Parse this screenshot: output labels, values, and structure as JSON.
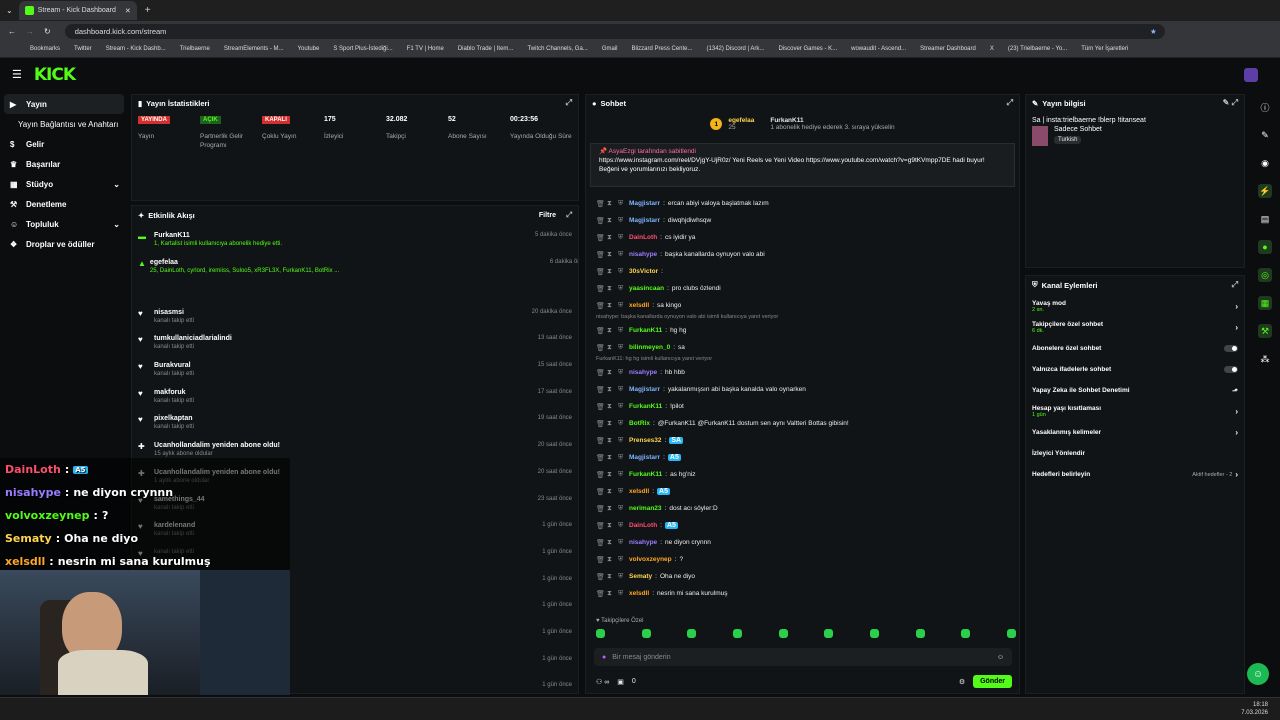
{
  "browser": {
    "tab_title": "Stream - Kick Dashboard",
    "url": "dashboard.kick.com/stream",
    "bookmarks": [
      "Bookmarks",
      "Twitter",
      "Stream - Kick Dashb...",
      "Trielbaerne",
      "StreamElements - M...",
      "Youtube",
      "S Sport Plus-İstediği...",
      "F1 TV | Home",
      "Diablo Trade | Item...",
      "Twitch Channels, Ga...",
      "Gmail",
      "Blizzard Press Cente...",
      "(1342) Discord | Ark...",
      "Discover Games - K...",
      "wowaudit - Ascend...",
      "Streamer Dashboard",
      "X",
      "(23) Trielbaerne - Yo...",
      "Tüm Yer İşaretleri"
    ]
  },
  "logo": "KICK",
  "sidebar": {
    "items": [
      {
        "label": "Yayın",
        "icon": "video-icon"
      },
      {
        "label": "Yayın Bağlantısı ve Anahtarı"
      },
      {
        "label": "Gelir",
        "icon": "money-icon"
      },
      {
        "label": "Başarılar",
        "icon": "trophy-icon"
      },
      {
        "label": "Stüdyo",
        "icon": "studio-icon"
      },
      {
        "label": "Denetleme",
        "icon": "hammer-icon"
      },
      {
        "label": "Topluluk",
        "icon": "people-icon"
      },
      {
        "label": "Droplar ve ödüller",
        "icon": "gift-icon"
      }
    ]
  },
  "stats": {
    "title": "Yayın İstatistikleri",
    "items": [
      {
        "value": "YAYINDA",
        "label": "Yayın",
        "kind": "red"
      },
      {
        "value": "AÇIK",
        "label": "Partnerlik Gelir Programı",
        "kind": "green"
      },
      {
        "value": "KAPALI",
        "label": "Çoklu Yayın",
        "kind": "red"
      },
      {
        "value": "175",
        "label": "İzleyici"
      },
      {
        "value": "32.082",
        "label": "Takipçi"
      },
      {
        "value": "52",
        "label": "Abone Sayısı"
      },
      {
        "value": "00:23:56",
        "label": "Yayında Olduğu Süre"
      }
    ]
  },
  "activity": {
    "title": "Etkinlik Akışı",
    "filter": "Filtre",
    "events": [
      {
        "name": "FurkanK11",
        "sub": "1, Kartalist isimli kullanıcıya abonelik hediye etti.",
        "time": "5 dakika önce",
        "icon": "gift-icon"
      },
      {
        "name": "egefelaa",
        "sub": "25, DainLoth, cyrlord, iremiiss, Suloo5, xR3FL3X, FurkanK11, BotRix ...",
        "time": "6 dakika önce",
        "icon": "cake-icon"
      },
      {
        "name": "nisasmsi",
        "sub": "kanalı takip etti",
        "time": "20 dakika önce",
        "icon": "heart-icon"
      },
      {
        "name": "tumkullaniciadlarialindi",
        "sub": "kanalı takip etti",
        "time": "13 saat önce",
        "icon": "heart-icon"
      },
      {
        "name": "Burakvural",
        "sub": "kanalı takip etti",
        "time": "15 saat önce",
        "icon": "heart-icon"
      },
      {
        "name": "makforuk",
        "sub": "kanalı takip etti",
        "time": "17 saat önce",
        "icon": "heart-icon"
      },
      {
        "name": "pixelkaptan",
        "sub": "kanalı takip etti",
        "time": "19 saat önce",
        "icon": "heart-icon"
      },
      {
        "name": "Ucanhollandalim yeniden abone oldu!",
        "sub": "15 aylık abone oldular",
        "time": "20 saat önce",
        "icon": "star-icon"
      },
      {
        "name": "Ucanhollandalim yeniden abone oldu!",
        "sub": "1 aylık abone oldular",
        "time": "20 saat önce",
        "icon": "star-icon"
      },
      {
        "name": "samethings_44",
        "sub": "kanalı takip etti",
        "time": "23 saat önce",
        "icon": "heart-icon"
      },
      {
        "name": "kardelenand",
        "sub": "kanalı takip etti",
        "time": "1 gün önce",
        "icon": "heart-icon"
      },
      {
        "name": "",
        "sub": "kanalı takip etti",
        "time": "1 gün önce",
        "icon": "heart-icon"
      },
      {
        "name": "",
        "sub": "",
        "time": "1 gün önce",
        "icon": ""
      },
      {
        "name": "",
        "sub": "",
        "time": "1 gün önce",
        "icon": ""
      },
      {
        "name": "",
        "sub": "",
        "time": "1 gün önce",
        "icon": ""
      },
      {
        "name": "",
        "sub": "",
        "time": "1 gün önce",
        "icon": ""
      },
      {
        "name": "",
        "sub": "",
        "time": "1 gün önce",
        "icon": ""
      }
    ]
  },
  "chat": {
    "title": "Sohbet",
    "top_user": "egefelaa",
    "top_count": "25",
    "top_gifter": "FurkanK11",
    "gift_note": "1 abonelik hediye ederek 3. sıraya yükselin",
    "pinned_by": "AsyaEzgi tarafından sabitlendi",
    "pinned_text": "https://www.instagram.com/reel/DVjgY-UjR0z/ Yeni Reels ve Yeni Video https://www.youtube.com/watch?v=g9tKVmpp7DE hadi buyur! Beğeni ve yorumlarınızı bekliyoruz.",
    "messages": [
      {
        "user": "Magjistarr",
        "text": "ercan abiyi valoya başlatmak lazım",
        "color": "#7fb3ff"
      },
      {
        "user": "Magjistarr",
        "text": "diwqhjdiwhsqw",
        "color": "#7fb3ff"
      },
      {
        "user": "DainLoth",
        "text": "cs iyidir ya",
        "color": "#ff4d6d"
      },
      {
        "user": "nisahype",
        "text": "başka kanallarda oynuyon valo abi",
        "color": "#9b7dff"
      },
      {
        "user": "30sVictor",
        "text": "",
        "color": "#ffd54f"
      },
      {
        "user": "yaasincaan",
        "text": "pro clubs özlendi",
        "color": "#53fc18"
      },
      {
        "user": "xelsdll",
        "text": "sa kingo",
        "color": "#ffa726"
      },
      {
        "reply": "nisahype: başka kanallarda oynuyon valo abi isimli kullanıcıya yanıt veriyor"
      },
      {
        "user": "FurkanK11",
        "text": "hg hg",
        "color": "#53fc18"
      },
      {
        "user": "bilinmeyen_0",
        "text": "sa",
        "color": "#53fc18"
      },
      {
        "reply": "FurkanK11: hg hg isimli kullanıcıya yanıt veriyor"
      },
      {
        "user": "nisahype",
        "text": "hb hbb",
        "color": "#9b7dff"
      },
      {
        "user": "Magjistarr",
        "text": "yakalanmışsın abi başka kanalda valo oynarken",
        "color": "#7fb3ff"
      },
      {
        "user": "FurkanK11",
        "text": "!pilot",
        "color": "#53fc18"
      },
      {
        "user": "BotRix",
        "text": "@FurkanK11 @FurkanK11 dostum sen aynı Valtteri Bottas gibisin!",
        "color": "#53fc18"
      },
      {
        "user": "Prenses32",
        "text": "SA",
        "color": "#ffd54f"
      },
      {
        "user": "Magjistarr",
        "text": "A5",
        "color": "#7fb3ff"
      },
      {
        "user": "FurkanK11",
        "text": "as hg'niz",
        "color": "#53fc18"
      },
      {
        "user": "xelsdll",
        "text": "A5",
        "color": "#ffa726"
      },
      {
        "user": "neriman23",
        "text": "dost acı söyler:D",
        "color": "#53fc18"
      },
      {
        "user": "DainLoth",
        "text": "A5",
        "color": "#ff4d6d"
      },
      {
        "user": "nisahype",
        "text": "ne diyon crynnn",
        "color": "#9b7dff"
      },
      {
        "user": "volvoxzeynep",
        "text": "?",
        "color": "#ffa726"
      },
      {
        "user": "Sematy",
        "text": "Oha ne diyo",
        "color": "#ffd54f"
      },
      {
        "user": "xelsdll",
        "text": "nesrin mi sana kurulmuş",
        "color": "#ffa726"
      }
    ],
    "followers_only": "Takipçilere Özel",
    "placeholder": "Bir mesaj gönderin",
    "send": "Gönder",
    "count": "0"
  },
  "stream_info": {
    "title": "Yayın bilgisi",
    "stream_title": "Sa | insta:trielbaerne !blerp !titanseat",
    "category": "Sadece Sohbet",
    "tag": "Turkish"
  },
  "channel": {
    "title": "Kanal Eylemleri",
    "rows": [
      {
        "label": "Yavaş mod",
        "sub": "2 sn.",
        "type": "chev"
      },
      {
        "label": "Takipçilere özel sohbet",
        "sub": "6 dk.",
        "type": "chev"
      },
      {
        "label": "Abonelere özel sohbet",
        "sub": "",
        "type": "toggle"
      },
      {
        "label": "Yalnızca ifadelerle sohbet",
        "sub": "",
        "type": "toggle"
      },
      {
        "label": "Yapay Zeka ile Sohbet Denetimi",
        "sub": "",
        "type": "ext"
      },
      {
        "label": "Hesap yaşı kısıtlaması",
        "sub": "1 gün",
        "type": "chev"
      },
      {
        "label": "Yasaklanmış kelimeler",
        "sub": "",
        "type": "chev"
      },
      {
        "label": "İzleyici Yönlendir",
        "sub": "",
        "type": "none"
      },
      {
        "label": "Hedefleri belirleyin",
        "sub": "",
        "type": "goal",
        "extra": "Aktif hedefler - 2"
      }
    ]
  },
  "overlay": [
    {
      "user": "DainLoth",
      "text": "A5",
      "color": "#ff4d6d"
    },
    {
      "user": "nisahype",
      "text": "ne diyon crynnn",
      "color": "#9b7dff"
    },
    {
      "user": "volvoxzeynep",
      "text": "?",
      "color": "#53fc18"
    },
    {
      "user": "Sematy",
      "text": "Oha ne diyo",
      "color": "#ffd54f"
    },
    {
      "user": "xelsdll",
      "text": "nesrin mi sana kurulmuş",
      "color": "#ffa726"
    }
  ],
  "clock": {
    "time": "18:18",
    "date": "7.03.2026"
  }
}
